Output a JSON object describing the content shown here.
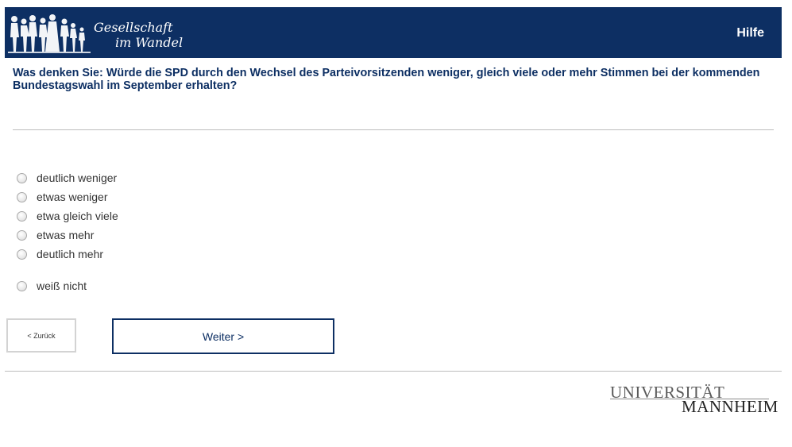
{
  "header": {
    "logo_line1": "Gesellschaft",
    "logo_line2": "im Wandel",
    "help_label": "Hilfe",
    "background_color": "#0d2f63"
  },
  "question": {
    "text": "Was denken Sie: Würde die SPD durch den Wechsel des Parteivorsitzenden weniger, gleich viele oder mehr Stimmen bei der kommenden Bundestagswahl im September erhalten?"
  },
  "options": [
    {
      "label": "deutlich weniger"
    },
    {
      "label": "etwas weniger"
    },
    {
      "label": "etwa gleich viele"
    },
    {
      "label": "etwas mehr"
    },
    {
      "label": "deutlich mehr"
    },
    {
      "label": "weiß nicht"
    }
  ],
  "navigation": {
    "back_label": "< Zurück",
    "next_label": "Weiter >"
  },
  "footer": {
    "university_line1": "UNIVERSITÄT",
    "university_line2": "MANNHEIM"
  }
}
